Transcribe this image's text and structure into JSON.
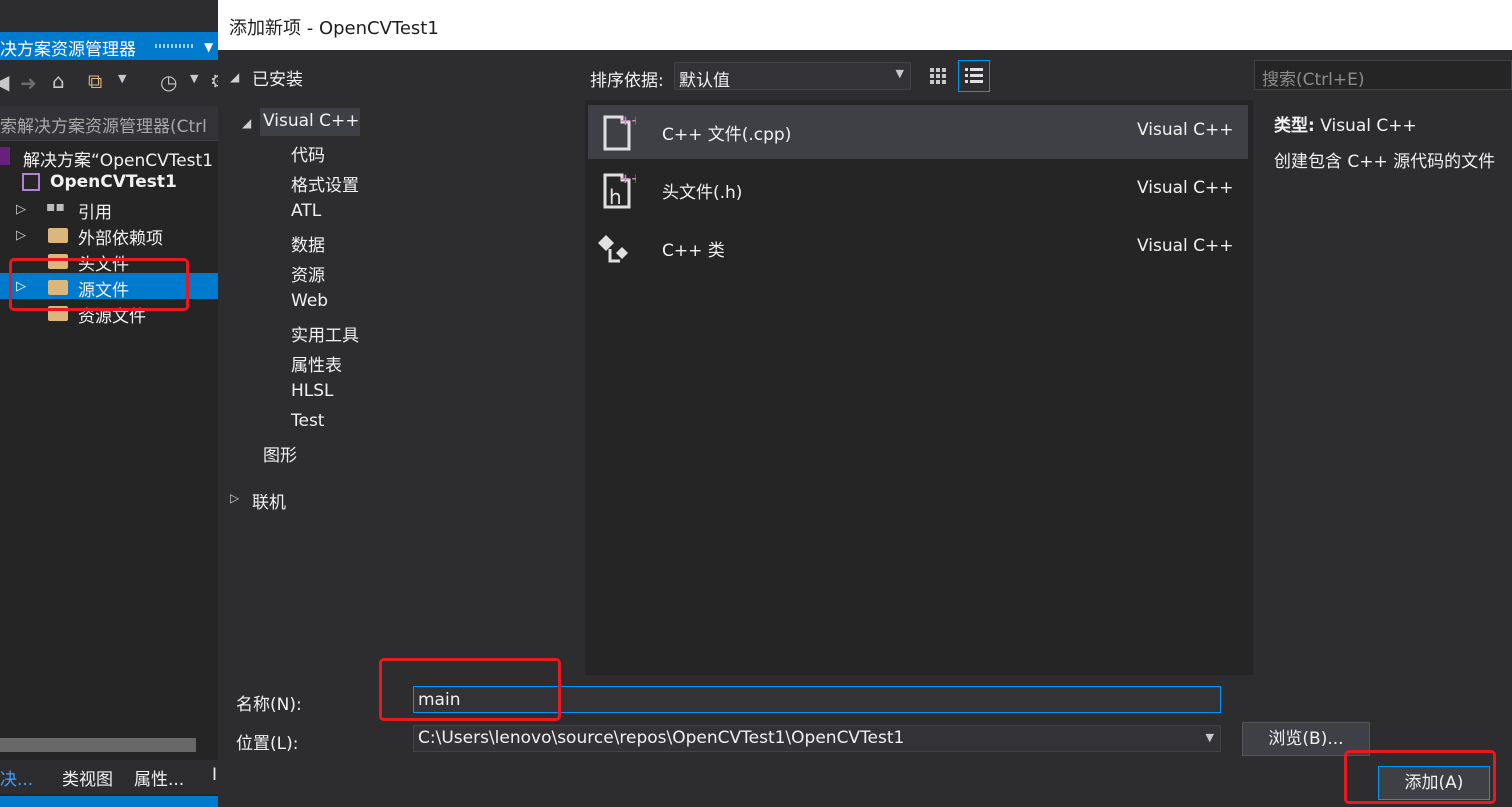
{
  "solution_explorer": {
    "title": "决方案资源管理器",
    "search_placeholder": "索解决方案资源管理器(Ctrl",
    "solution_label": "解决方案“OpenCVTest1",
    "project_name": "OpenCVTest1",
    "items": [
      {
        "label": "引用"
      },
      {
        "label": "外部依赖项"
      },
      {
        "label": "头文件"
      },
      {
        "label": "源文件"
      },
      {
        "label": "资源文件"
      }
    ],
    "bottom_tabs": [
      "决...",
      "类视图",
      "属性...",
      "I"
    ]
  },
  "dialog": {
    "title": "添加新项 - OpenCVTest1",
    "nav": {
      "installed": "已安装",
      "visual_cpp": "Visual C++",
      "sub_items": [
        "代码",
        "格式设置",
        "ATL",
        "数据",
        "资源",
        "Web",
        "实用工具",
        "属性表",
        "HLSL",
        "Test"
      ],
      "graphics": "图形",
      "online": "联机"
    },
    "sort_label": "排序依据:",
    "sort_value": "默认值",
    "search_placeholder": "搜索(Ctrl+E)",
    "templates": [
      {
        "name": "C++ 文件(.cpp)",
        "language": "Visual C++"
      },
      {
        "name": "头文件(.h)",
        "language": "Visual C++"
      },
      {
        "name": "C++ 类",
        "language": "Visual C++"
      }
    ],
    "info": {
      "type_label": "类型:",
      "type_value": "Visual C++",
      "description": "创建包含 C++ 源代码的文件"
    },
    "name_label": "名称(N):",
    "name_value": "main",
    "location_label": "位置(L):",
    "location_value": "C:\\Users\\lenovo\\source\\repos\\OpenCVTest1\\OpenCVTest1",
    "browse_button": "浏览(B)...",
    "add_button": "添加(A)"
  },
  "colors": {
    "accent": "#007acc",
    "highlight": "#e8191f",
    "background": "#2d2d30"
  }
}
